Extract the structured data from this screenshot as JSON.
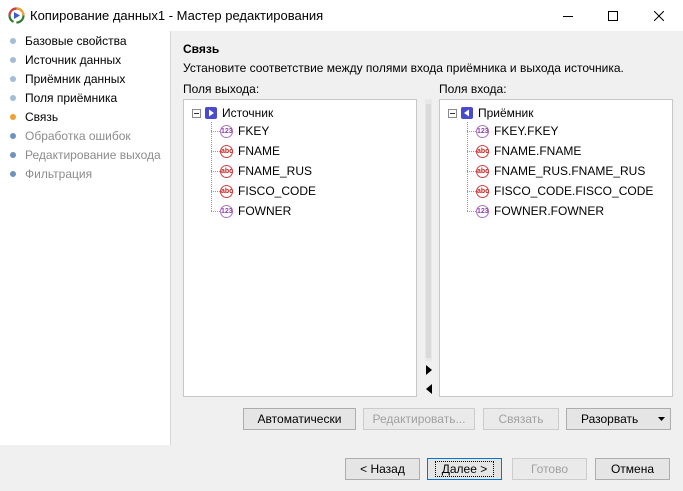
{
  "window": {
    "title": "Копирование данных1 - Мастер редактирования",
    "app_icon": "report-wizard-icon",
    "controls": [
      "minimize-icon",
      "maximize-icon",
      "close-icon"
    ]
  },
  "nav": {
    "items": [
      {
        "label": "Базовые свойства",
        "state": "done"
      },
      {
        "label": "Источник данных",
        "state": "done"
      },
      {
        "label": "Приёмник данных",
        "state": "done"
      },
      {
        "label": "Поля приёмника",
        "state": "done"
      },
      {
        "label": "Связь",
        "state": "active"
      },
      {
        "label": "Обработка ошибок",
        "state": "pending"
      },
      {
        "label": "Редактирование выхода",
        "state": "pending"
      },
      {
        "label": "Фильтрация",
        "state": "pending"
      }
    ]
  },
  "main": {
    "title": "Связь",
    "description": "Установите соответствие между полями входа приёмника и выхода источника.",
    "output_panel": {
      "caption": "Поля выхода:",
      "root": "Источник",
      "fields": [
        {
          "name": "FKEY",
          "type": "123"
        },
        {
          "name": "FNAME",
          "type": "abc"
        },
        {
          "name": "FNAME_RUS",
          "type": "abc"
        },
        {
          "name": "FISCO_CODE",
          "type": "abc"
        },
        {
          "name": "FOWNER",
          "type": "123"
        }
      ]
    },
    "input_panel": {
      "caption": "Поля входа:",
      "root": "Приёмник",
      "fields": [
        {
          "name": "FKEY.FKEY",
          "type": "123"
        },
        {
          "name": "FNAME.FNAME",
          "type": "abc"
        },
        {
          "name": "FNAME_RUS.FNAME_RUS",
          "type": "abc"
        },
        {
          "name": "FISCO_CODE.FISCO_CODE",
          "type": "abc"
        },
        {
          "name": "FOWNER.FOWNER",
          "type": "123"
        }
      ]
    },
    "actions": {
      "auto": "Автоматически",
      "edit": "Редактировать...",
      "link": "Связать",
      "unlink": "Разорвать"
    }
  },
  "footer": {
    "back": "< Назад",
    "next": "Далее >",
    "finish": "Готово",
    "cancel": "Отмена"
  },
  "colors": {
    "accent": "#0078d7",
    "active_step": "#f0a030",
    "source_icon": "#4a4acf",
    "numeric_type": "#9040a8",
    "string_type": "#c02020"
  }
}
